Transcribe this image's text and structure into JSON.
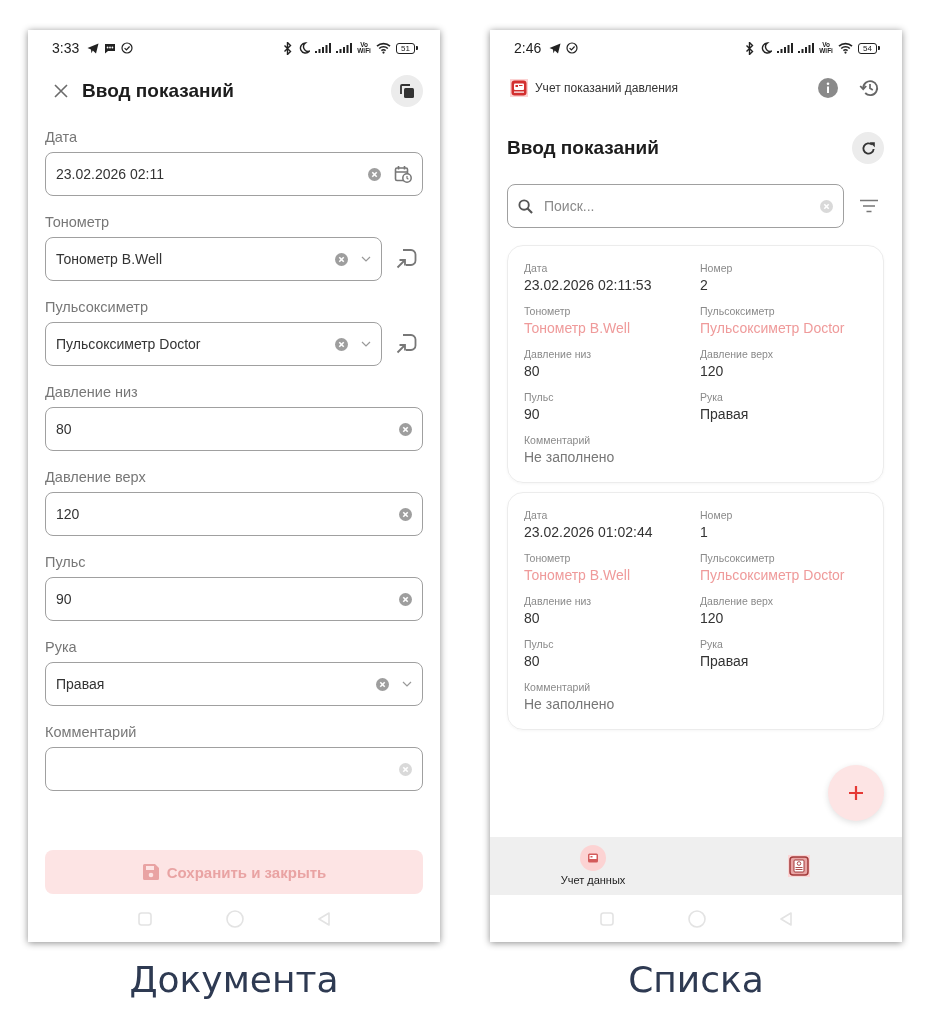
{
  "screens": [
    {
      "kind": "form",
      "status_bar": {
        "time": "3:33",
        "wifi_calling": "Vo WiFi",
        "battery": "51"
      },
      "title": "Ввод показаний",
      "fields": [
        {
          "label": "Дата",
          "value": "23.02.2026 02:11",
          "kind": "datetime"
        },
        {
          "label": "Тонометр",
          "value": "Тонометр B.Well",
          "kind": "reference"
        },
        {
          "label": "Пульсоксиметр",
          "value": "Пульсоксиметр Doctor",
          "kind": "reference"
        },
        {
          "label": "Давление низ",
          "value": "80",
          "kind": "text"
        },
        {
          "label": "Давление верх",
          "value": "120",
          "kind": "text"
        },
        {
          "label": "Пульс",
          "value": "90",
          "kind": "text"
        },
        {
          "label": "Рука",
          "value": "Правая",
          "kind": "select"
        },
        {
          "label": "Комментарий",
          "kind": "text"
        }
      ],
      "save_button": {
        "label": "Сохранить и закрыть",
        "disabled": true
      },
      "caption": "Документа"
    },
    {
      "kind": "list",
      "status_bar": {
        "time": "2:46",
        "wifi_calling": "Vo WiFi",
        "battery": "54"
      },
      "app_title": "Учет показаний давления",
      "title": "Ввод показаний",
      "search": {
        "placeholder": "Поиск..."
      },
      "records": [
        {
          "fields": [
            {
              "label": "Дата",
              "value": "23.02.2026 02:11:53",
              "kind": "value"
            },
            {
              "label": "Номер",
              "value": "2",
              "kind": "value"
            },
            {
              "label": "Тонометр",
              "value": "Тонометр B.Well",
              "kind": "link"
            },
            {
              "label": "Пульсоксиметр",
              "value": "Пульсоксиметр Doctor",
              "kind": "link"
            },
            {
              "label": "Давление низ",
              "value": "80",
              "kind": "value"
            },
            {
              "label": "Давление верх",
              "value": "120",
              "kind": "value"
            },
            {
              "label": "Пульс",
              "value": "90",
              "kind": "value"
            },
            {
              "label": "Рука",
              "value": "Правая",
              "kind": "value"
            },
            {
              "label": "Комментарий",
              "value": "Не заполнено",
              "kind": "placeholder"
            }
          ]
        },
        {
          "fields": [
            {
              "label": "Дата",
              "value": "23.02.2026 01:02:44",
              "kind": "value"
            },
            {
              "label": "Номер",
              "value": "1",
              "kind": "value"
            },
            {
              "label": "Тонометр",
              "value": "Тонометр B.Well",
              "kind": "link"
            },
            {
              "label": "Пульсоксиметр",
              "value": "Пульсоксиметр Doctor",
              "kind": "link"
            },
            {
              "label": "Давление низ",
              "value": "80",
              "kind": "value"
            },
            {
              "label": "Давление верх",
              "value": "120",
              "kind": "value"
            },
            {
              "label": "Пульс",
              "value": "80",
              "kind": "value"
            },
            {
              "label": "Рука",
              "value": "Правая",
              "kind": "value"
            },
            {
              "label": "Комментарий",
              "value": "Не заполнено",
              "kind": "placeholder"
            }
          ]
        }
      ],
      "bottom_nav": [
        {
          "label": "Учет данных",
          "selected": true
        },
        {
          "selected": false
        }
      ],
      "caption": "Списка"
    }
  ]
}
